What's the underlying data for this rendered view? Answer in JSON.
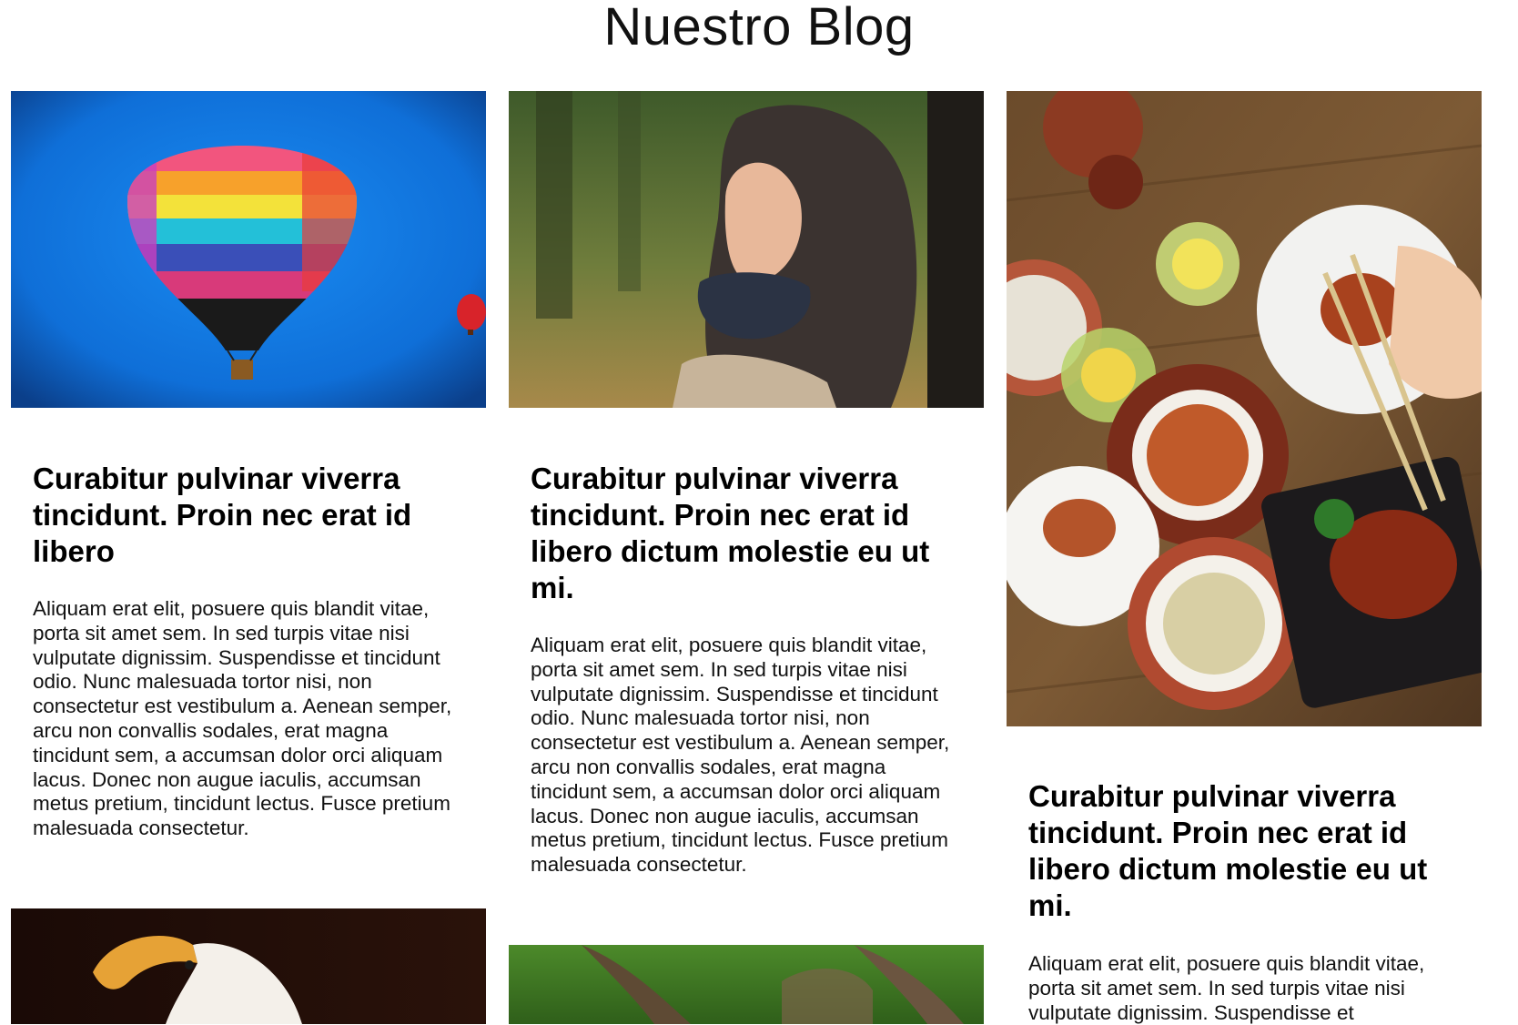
{
  "page": {
    "title": "Nuestro Blog"
  },
  "posts": [
    {
      "title": "Curabitur pulvinar viverra tincidunt. Proin nec erat id libero",
      "body": "Aliquam erat elit, posuere quis blandit vitae, porta sit amet sem. In sed turpis vitae nisi vulputate dignissim. Suspendisse et tincidunt odio. Nunc malesuada tortor nisi, non consectetur est vestibulum a. Aenean semper, arcu non convallis sodales, erat magna tincidunt sem, a accumsan dolor orci aliquam lacus. Donec non augue iaculis, accumsan metus pretium, tincidunt lectus. Fusce pretium malesuada consectetur.",
      "image": "hot-air-balloon-image"
    },
    {
      "title": "Curabitur pulvinar viverra tincidunt. Proin nec erat id libero dictum molestie eu ut mi.",
      "body": "Aliquam erat elit, posuere quis blandit vitae, porta sit amet sem. In sed turpis vitae nisi vulputate dignissim. Suspendisse et tincidunt odio. Nunc malesuada tortor nisi, non consectetur est vestibulum a. Aenean semper, arcu non convallis sodales, erat magna tincidunt sem, a accumsan dolor orci aliquam lacus. Donec non augue iaculis, accumsan metus pretium, tincidunt lectus. Fusce pretium malesuada consectetur.",
      "image": "woman-portrait-image"
    },
    {
      "title": "Curabitur pulvinar viverra tincidunt. Proin nec erat id libero dictum molestie eu ut mi.",
      "body": "Aliquam erat elit, posuere quis blandit vitae, porta sit amet sem. In sed turpis vitae nisi vulputate dignissim. Suspendisse et",
      "image": "food-table-image"
    },
    {
      "image": "eagle-image"
    },
    {
      "image": "owl-image"
    }
  ]
}
